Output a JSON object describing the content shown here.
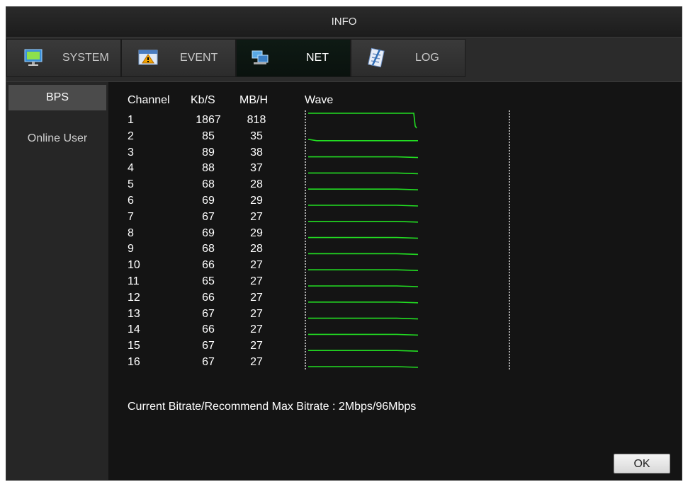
{
  "window": {
    "title": "INFO"
  },
  "tabs": [
    {
      "label": "SYSTEM",
      "icon": "monitor-icon",
      "active": false
    },
    {
      "label": "EVENT",
      "icon": "warning-icon",
      "active": false
    },
    {
      "label": "NET",
      "icon": "network-icon",
      "active": true
    },
    {
      "label": "LOG",
      "icon": "notepad-icon",
      "active": false
    }
  ],
  "sidebar": {
    "items": [
      {
        "label": "BPS",
        "active": true
      },
      {
        "label": "Online User",
        "active": false
      }
    ]
  },
  "table": {
    "headers": {
      "channel": "Channel",
      "kbs": "Kb/S",
      "mbh": "MB/H",
      "wave": "Wave"
    },
    "rows": [
      {
        "channel": "1",
        "kbs": "1867",
        "mbh": "818"
      },
      {
        "channel": "2",
        "kbs": "85",
        "mbh": "35"
      },
      {
        "channel": "3",
        "kbs": "89",
        "mbh": "38"
      },
      {
        "channel": "4",
        "kbs": "88",
        "mbh": "37"
      },
      {
        "channel": "5",
        "kbs": "68",
        "mbh": "28"
      },
      {
        "channel": "6",
        "kbs": "69",
        "mbh": "29"
      },
      {
        "channel": "7",
        "kbs": "67",
        "mbh": "27"
      },
      {
        "channel": "8",
        "kbs": "69",
        "mbh": "29"
      },
      {
        "channel": "9",
        "kbs": "68",
        "mbh": "28"
      },
      {
        "channel": "10",
        "kbs": "66",
        "mbh": "27"
      },
      {
        "channel": "11",
        "kbs": "65",
        "mbh": "27"
      },
      {
        "channel": "12",
        "kbs": "66",
        "mbh": "27"
      },
      {
        "channel": "13",
        "kbs": "67",
        "mbh": "27"
      },
      {
        "channel": "14",
        "kbs": "66",
        "mbh": "27"
      },
      {
        "channel": "15",
        "kbs": "67",
        "mbh": "27"
      },
      {
        "channel": "16",
        "kbs": "67",
        "mbh": "27"
      }
    ]
  },
  "wave": {
    "line_color": "#22dd22"
  },
  "footer": {
    "bitrate_text": "Current Bitrate/Recommend Max Bitrate : 2Mbps/96Mbps"
  },
  "buttons": {
    "ok_label": "OK"
  }
}
